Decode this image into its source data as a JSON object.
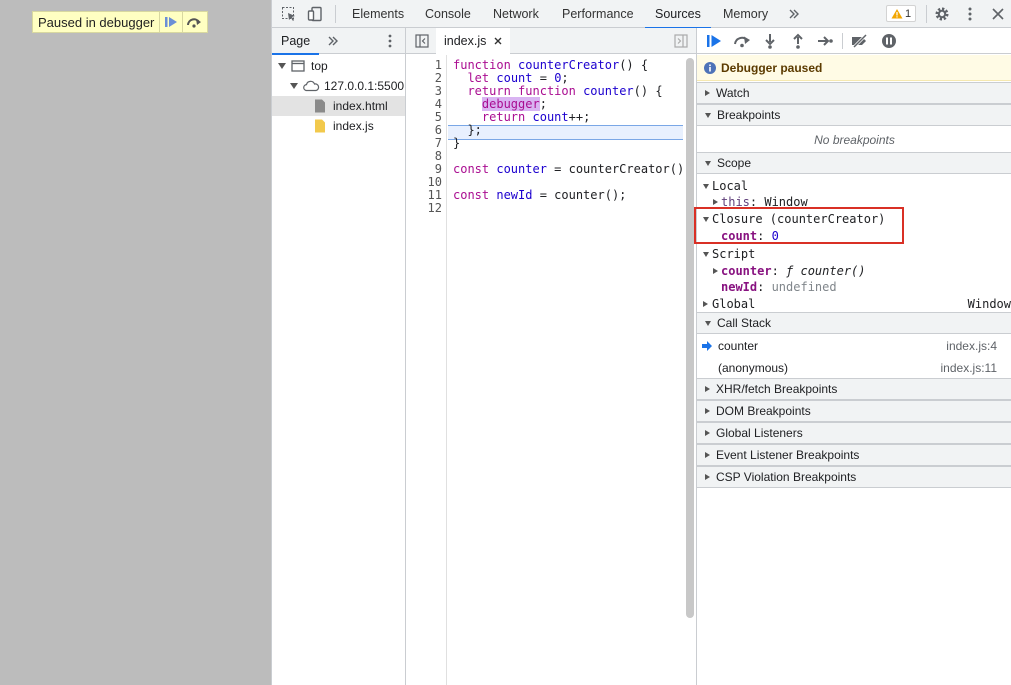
{
  "page": {
    "paused_label": "Paused in debugger"
  },
  "toolbar": {
    "tabs": [
      "Elements",
      "Console",
      "Network",
      "Performance",
      "Sources",
      "Memory"
    ],
    "active_tab": "Sources",
    "warning_count": "1"
  },
  "navigator": {
    "tab_label": "Page",
    "tree": {
      "top": "top",
      "origin": "127.0.0.1:5500",
      "files": [
        "index.html",
        "index.js"
      ]
    }
  },
  "editor": {
    "file_tab": "index.js",
    "line_numbers": [
      "1",
      "2",
      "3",
      "4",
      "5",
      "6",
      "7",
      "8",
      "9",
      "10",
      "11",
      "12"
    ],
    "lines": [
      "function counterCreator() {",
      "  let count = 0;",
      "  return function counter() {",
      "    debugger;",
      "    return count++;",
      "  };",
      "}",
      "",
      "const counter = counterCreator()",
      "",
      "const newId = counter();",
      ""
    ]
  },
  "debugger": {
    "paused_message": "Debugger paused",
    "sections": {
      "watch": "Watch",
      "breakpoints": "Breakpoints",
      "no_breakpoints": "No breakpoints",
      "scope": "Scope",
      "call_stack": "Call Stack",
      "xhr": "XHR/fetch Breakpoints",
      "dom": "DOM Breakpoints",
      "global_listeners": "Global Listeners",
      "event_listener": "Event Listener Breakpoints",
      "csp": "CSP Violation Breakpoints"
    },
    "scope": {
      "local_label": "Local",
      "this_name": "this",
      "this_value": "Window",
      "closure_label": "Closure (counterCreator)",
      "count_name": "count",
      "count_value": "0",
      "script_label": "Script",
      "counter_name": "counter",
      "counter_value": "ƒ counter()",
      "newid_name": "newId",
      "newid_value": "undefined",
      "global_label": "Global",
      "global_value": "Window"
    },
    "call_stack": [
      {
        "fn": "counter",
        "loc": "index.js:4"
      },
      {
        "fn": "(anonymous)",
        "loc": "index.js:11"
      }
    ]
  }
}
